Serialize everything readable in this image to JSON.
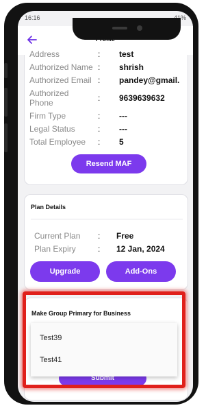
{
  "status_bar": {
    "time": "16:16",
    "battery": "41%"
  },
  "header": {
    "title": "Profile"
  },
  "profile_fields": [
    {
      "label": "Address",
      "value": "test"
    },
    {
      "label": "Authorized Name",
      "value": "shrish"
    },
    {
      "label": "Authorized Email",
      "value": "pandey@gmail."
    },
    {
      "label": "Authorized Phone",
      "value": "9639639632"
    },
    {
      "label": "Firm Type",
      "value": "---"
    },
    {
      "label": "Legal Status",
      "value": "---"
    },
    {
      "label": "Total Employee",
      "value": "5"
    }
  ],
  "separator": ":",
  "resend_button": "Resend MAF",
  "plan": {
    "title": "Plan Details",
    "rows": [
      {
        "label": "Current Plan",
        "value": "Free"
      },
      {
        "label": "Plan Expiry",
        "value": "12 Jan, 2024"
      }
    ],
    "upgrade_label": "Upgrade",
    "addons_label": "Add-Ons"
  },
  "group_primary": {
    "title": "Make Group Primary for Business",
    "options": [
      "Test39",
      "Test41"
    ],
    "submit_label": "Submit"
  },
  "colors": {
    "accent": "#7c3aed",
    "highlight": "#e0201b"
  }
}
